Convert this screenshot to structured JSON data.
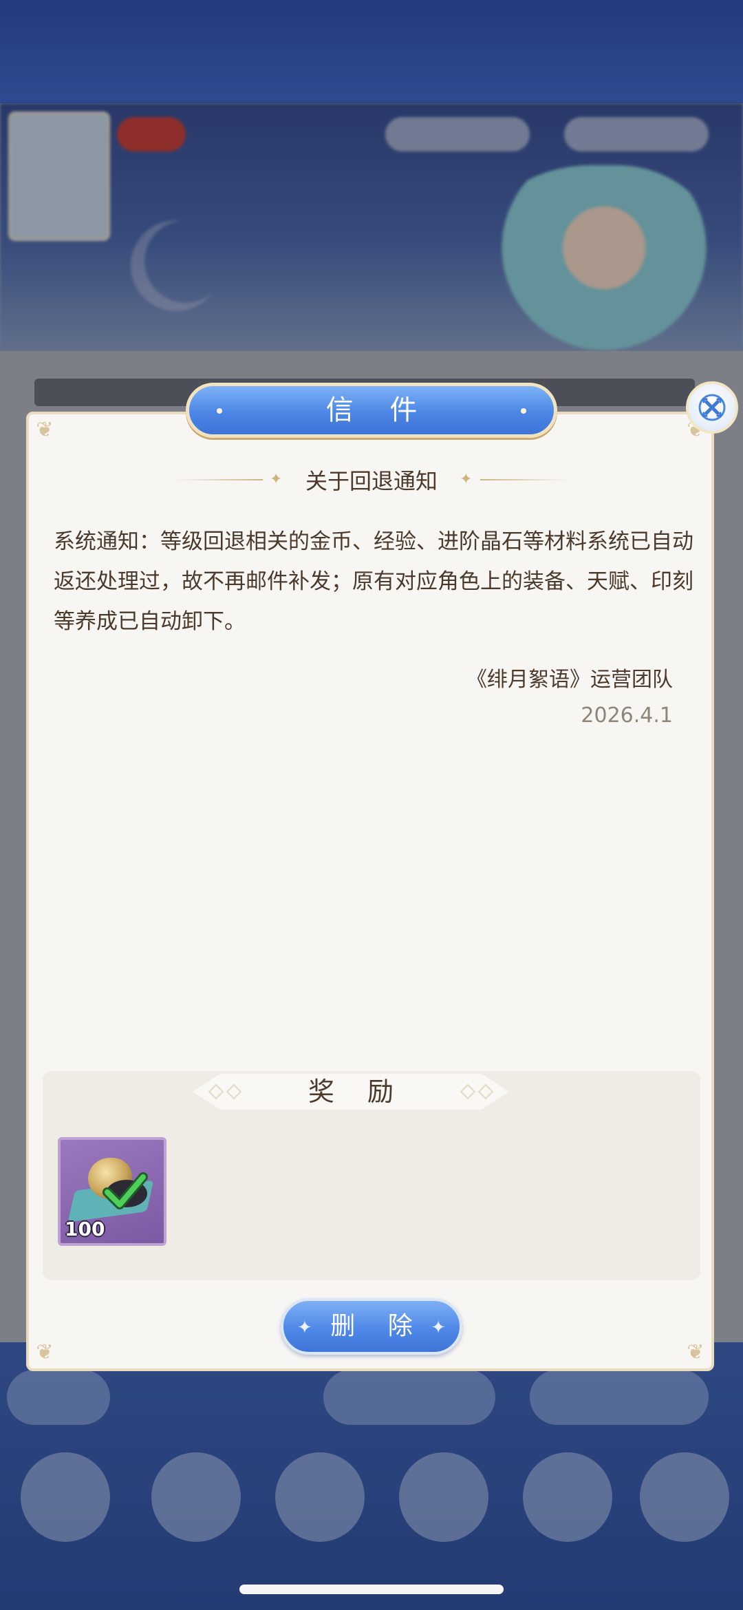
{
  "dialog": {
    "title": "信 件",
    "subject": "关于回退通知",
    "body": "系统通知：等级回退相关的金币、经验、进阶晶石等材料系统已自动返还处理过，故不再邮件补发；原有对应角色上的装备、天赋、印刻等养成已自动卸下。",
    "signature": "《绯月絮语》运营团队",
    "date": "2026.4.1",
    "reward_title": "奖 励",
    "rewards": [
      {
        "icon": "material-stone-icon",
        "count": "100"
      }
    ],
    "delete_label": "删 除"
  },
  "colors": {
    "accent_blue": "#4c86e6",
    "text_brown": "#4b3a2b",
    "date_gray": "#8f8478",
    "panel_bg": "#f8f6f3",
    "border_gold": "#e9dcc0"
  }
}
